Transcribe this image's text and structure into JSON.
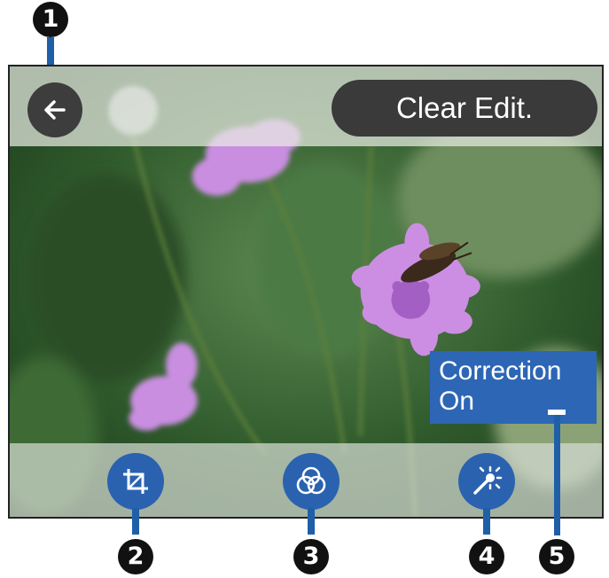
{
  "callouts": [
    "1",
    "2",
    "3",
    "4",
    "5"
  ],
  "toolbar_top": {
    "back_icon": "arrow-left-icon",
    "clear_edit_label": "Clear Edit."
  },
  "toolbar_bottom": {
    "crop_icon": "crop-icon",
    "filter_icon": "filter-circles-icon",
    "adjust_icon": "brightness-sparkle-icon"
  },
  "correction_label": "Correction\nOn",
  "colors": {
    "accent": "#2a62b0",
    "callout_leader": "#1f5fa8",
    "dark_button": "#3a3a3a",
    "flower": "#c98ee0"
  }
}
